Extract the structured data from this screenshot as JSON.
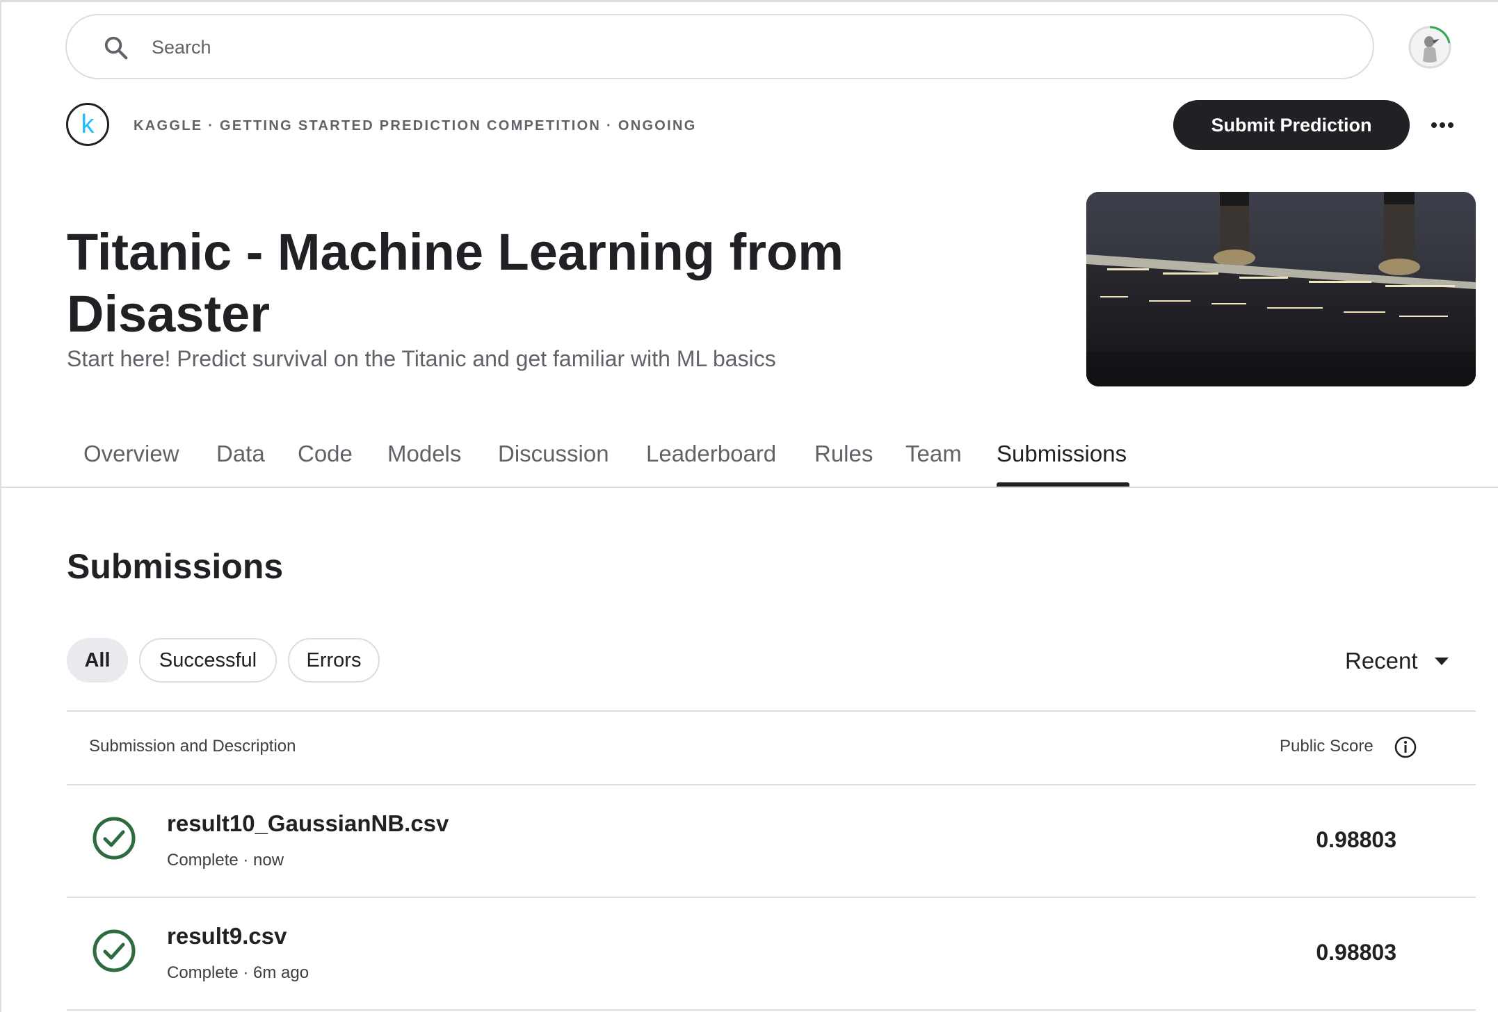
{
  "search": {
    "placeholder": "Search"
  },
  "header": {
    "kicker": "KAGGLE · GETTING STARTED PREDICTION COMPETITION · ONGOING",
    "logo_letter": "k",
    "submit_label": "Submit Prediction"
  },
  "competition": {
    "title": "Titanic - Machine Learning from Disaster",
    "subtitle": "Start here! Predict survival on the Titanic and get familiar with ML basics"
  },
  "tabs": [
    {
      "label": "Overview"
    },
    {
      "label": "Data"
    },
    {
      "label": "Code"
    },
    {
      "label": "Models"
    },
    {
      "label": "Discussion"
    },
    {
      "label": "Leaderboard"
    },
    {
      "label": "Rules"
    },
    {
      "label": "Team"
    },
    {
      "label": "Submissions",
      "active": true
    }
  ],
  "submissions": {
    "heading": "Submissions",
    "filters": [
      {
        "label": "All",
        "active": true
      },
      {
        "label": "Successful"
      },
      {
        "label": "Errors"
      }
    ],
    "sort_label": "Recent",
    "columns": {
      "description": "Submission and Description",
      "score": "Public Score"
    },
    "rows": [
      {
        "file": "result10_GaussianNB.csv",
        "status": "Complete · now",
        "score": "0.98803"
      },
      {
        "file": "result9.csv",
        "status": "Complete · 6m ago",
        "score": "0.98803"
      }
    ]
  },
  "colors": {
    "primary_dark": "#202124",
    "kaggle_blue": "#20beff",
    "success_green": "#2e6b3e",
    "divider": "#dadce0"
  },
  "icons": {
    "search": "search-icon",
    "more": "more-horizontal-icon",
    "info": "info-icon",
    "status": "check-circle-icon",
    "sort": "caret-down-icon"
  }
}
